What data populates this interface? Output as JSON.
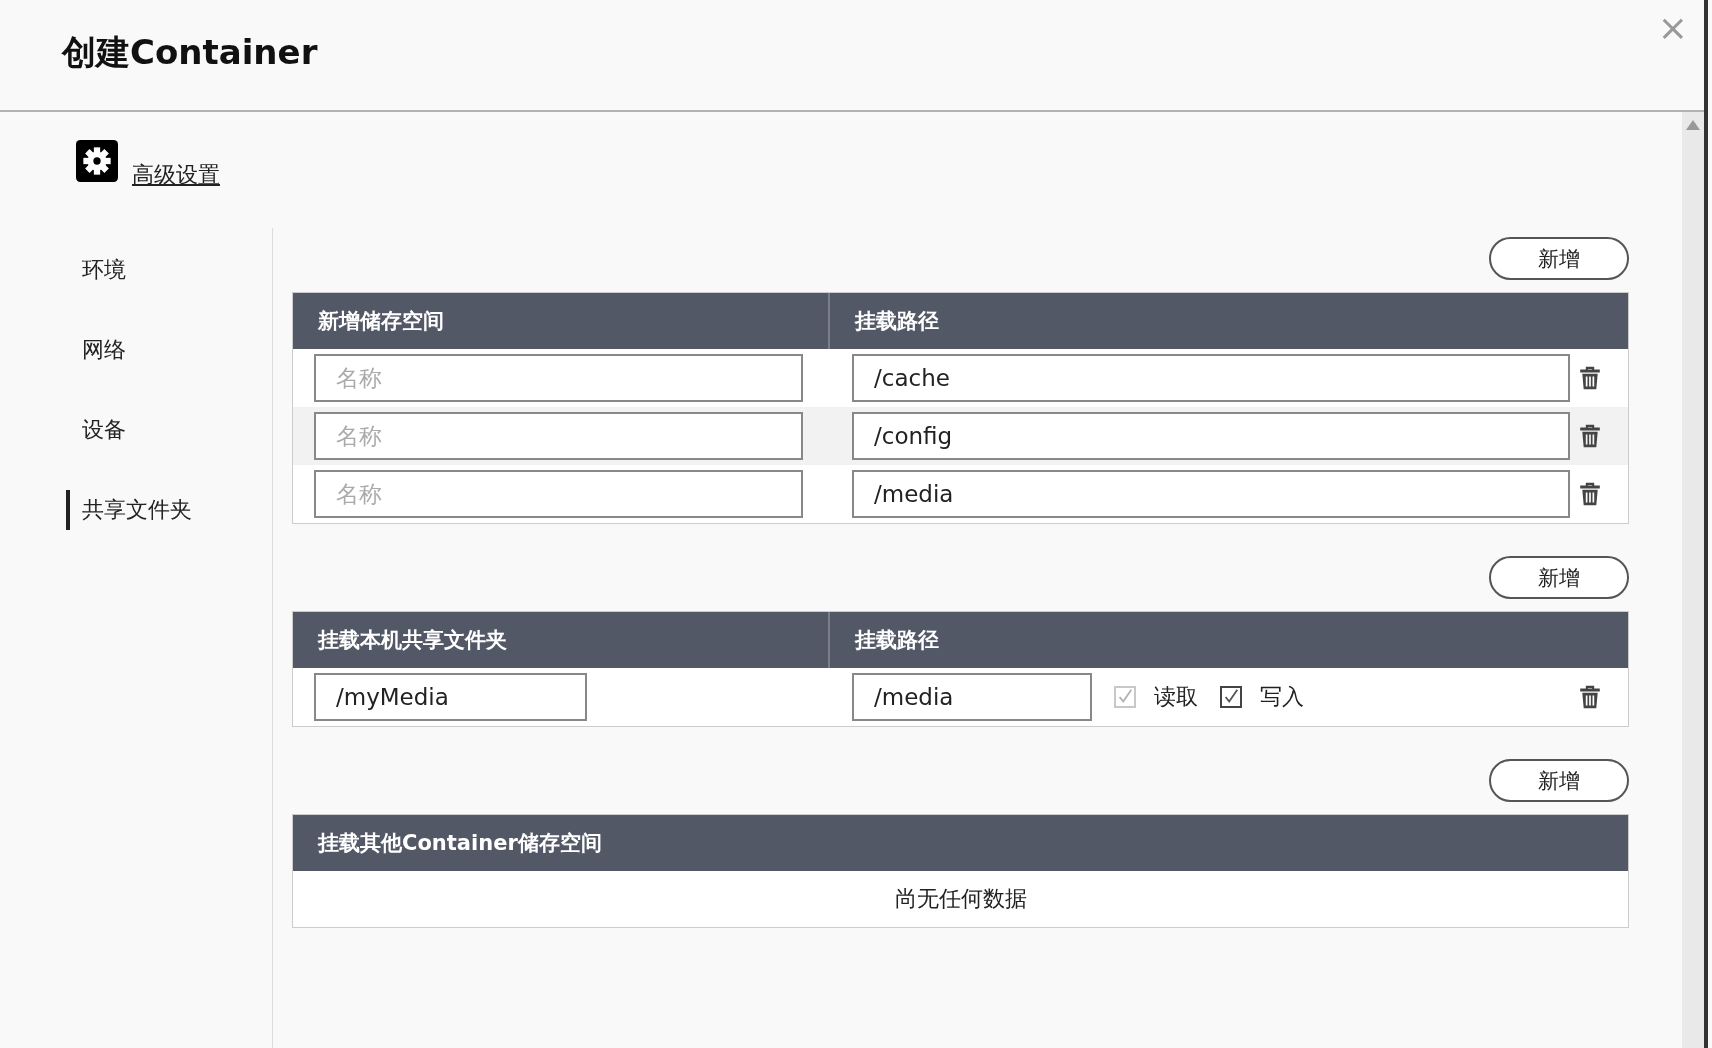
{
  "dialog": {
    "title": "创建Container",
    "close": "×"
  },
  "section": {
    "title": "高级设置"
  },
  "sidebar": {
    "items": [
      {
        "label": "环境",
        "selected": false
      },
      {
        "label": "网络",
        "selected": false
      },
      {
        "label": "设备",
        "selected": false
      },
      {
        "label": "共享文件夹",
        "selected": true
      }
    ]
  },
  "tables": [
    {
      "kind": "volume",
      "add_button": "新增",
      "columns": [
        "新增储存空间",
        "挂载路径"
      ],
      "rows": [
        {
          "name_placeholder": "名称",
          "path": "/cache",
          "hovered": false
        },
        {
          "name_placeholder": "名称",
          "path": "/config",
          "hovered": true
        },
        {
          "name_placeholder": "名称",
          "path": "/media",
          "hovered": false
        }
      ]
    },
    {
      "kind": "folder",
      "add_button": "新增",
      "columns": [
        "挂载本机共享文件夹",
        "挂载路径"
      ],
      "rows": [
        {
          "name": "/myMedia",
          "path": "/media",
          "read": {
            "label": "读取",
            "checked": true,
            "disabled": true
          },
          "write": {
            "label": "写入",
            "checked": true,
            "disabled": false
          }
        }
      ]
    },
    {
      "kind": "container",
      "add_button": "新增",
      "columns": [
        "挂载其他Container储存空间"
      ],
      "empty_message": "尚无任何数据"
    }
  ]
}
